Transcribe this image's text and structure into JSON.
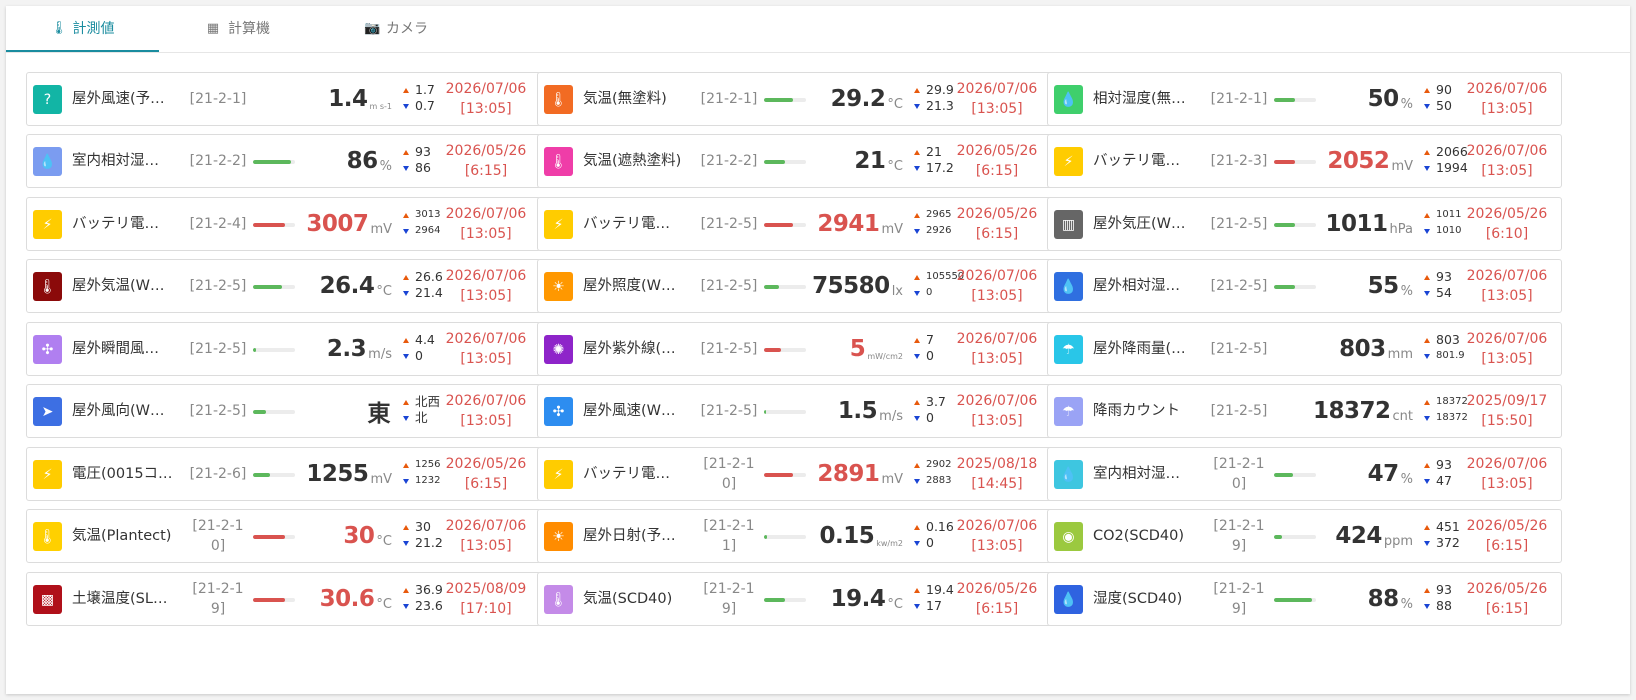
{
  "tabs": [
    {
      "label": "計測値",
      "icon": "thermometer-icon",
      "glyph": "🌡",
      "active": true
    },
    {
      "label": "計算機",
      "icon": "calculator-icon",
      "glyph": "▦",
      "active": false
    },
    {
      "label": "カメラ",
      "icon": "camera-icon",
      "glyph": "📷",
      "active": false
    }
  ],
  "colors": {
    "accent": "#1a8c9f",
    "alert": "#d9534f",
    "bar_ok": "#5cb85c",
    "bar_alert": "#d9534f"
  },
  "cards": [
    {
      "name": "屋外風速(予…",
      "id": "[21-2-1]",
      "value": "1.4",
      "unit": "m s-1",
      "unit_small": true,
      "max": "1.7",
      "min": "0.7",
      "date": "2026/07/06",
      "time": "[13:05]",
      "icon": "question-icon",
      "glyph": "?",
      "color": "#12b5a5",
      "bar": null,
      "alert": false
    },
    {
      "name": "気温(無塗料)",
      "id": "[21-2-1]",
      "value": "29.2",
      "unit": "°C",
      "max": "29.9",
      "min": "21.3",
      "date": "2026/07/06",
      "time": "[13:05]",
      "icon": "thermometer-icon",
      "glyph": "🌡",
      "color": "#f26b23",
      "bar": 0.7,
      "alert": false
    },
    {
      "name": "相対湿度(無…",
      "id": "[21-2-1]",
      "value": "50",
      "unit": "%",
      "max": "90",
      "min": "50",
      "date": "2026/07/06",
      "time": "[13:05]",
      "icon": "humidity-drop-icon",
      "glyph": "💧",
      "color": "#3fcf6c",
      "bar": 0.5,
      "alert": false
    },
    {
      "name": "室内相対湿…",
      "id": "[21-2-2]",
      "value": "86",
      "unit": "%",
      "max": "93",
      "min": "86",
      "date": "2026/05/26",
      "time": "[6:15]",
      "icon": "humidity-drop-icon",
      "glyph": "💧",
      "color": "#7b9cf0",
      "bar": 0.9,
      "alert": false
    },
    {
      "name": "気温(遮熱塗料)",
      "id": "[21-2-2]",
      "value": "21",
      "unit": "°C",
      "max": "21",
      "min": "17.2",
      "date": "2026/05/26",
      "time": "[6:15]",
      "icon": "thermometer-icon",
      "glyph": "🌡",
      "color": "#ef3da8",
      "bar": 0.5,
      "alert": false
    },
    {
      "name": "バッテリ電…",
      "id": "[21-2-3]",
      "value": "2052",
      "unit": "mV",
      "max": "2066",
      "min": "1994",
      "date": "2026/07/06",
      "time": "[13:05]",
      "icon": "battery-voltage-icon",
      "glyph": "⚡",
      "color": "#ffcc00",
      "bar": 0.5,
      "alert": true
    },
    {
      "name": "バッテリ電…",
      "id": "[21-2-4]",
      "value": "3007",
      "unit": "mV",
      "max": "3013",
      "min": "2964",
      "date": "2026/07/06",
      "time": "[13:05]",
      "icon": "battery-voltage-icon",
      "glyph": "⚡",
      "color": "#ffcc00",
      "bar": 0.75,
      "alert": true,
      "range_small": true
    },
    {
      "name": "バッテリ電…",
      "id": "[21-2-5]",
      "value": "2941",
      "unit": "mV",
      "max": "2965",
      "min": "2926",
      "date": "2026/05/26",
      "time": "[6:15]",
      "icon": "battery-voltage-icon",
      "glyph": "⚡",
      "color": "#ffcc00",
      "bar": 0.7,
      "alert": true,
      "range_small": true
    },
    {
      "name": "屋外気圧(W…",
      "id": "[21-2-5]",
      "value": "1011",
      "unit": "hPa",
      "max": "1011",
      "min": "1010",
      "date": "2026/05/26",
      "time": "[6:10]",
      "icon": "pressure-icon",
      "glyph": "▥",
      "color": "#666666",
      "bar": 0.5,
      "alert": false,
      "range_small": true
    },
    {
      "name": "屋外気温(W…",
      "id": "[21-2-5]",
      "value": "26.4",
      "unit": "°C",
      "max": "26.6",
      "min": "21.4",
      "date": "2026/07/06",
      "time": "[13:05]",
      "icon": "thermometer-icon",
      "glyph": "🌡",
      "color": "#8b0a0a",
      "bar": 0.7,
      "alert": false
    },
    {
      "name": "屋外照度(W…",
      "id": "[21-2-5]",
      "value": "75580",
      "unit": "lx",
      "max": "105550",
      "min": "0",
      "date": "2026/07/06",
      "time": "[13:05]",
      "icon": "illuminance-icon",
      "glyph": "☀",
      "color": "#ff9800",
      "bar": 0.35,
      "alert": false,
      "range_small": true
    },
    {
      "name": "屋外相対湿…",
      "id": "[21-2-5]",
      "value": "55",
      "unit": "%",
      "max": "93",
      "min": "54",
      "date": "2026/07/06",
      "time": "[13:05]",
      "icon": "humidity-drop-icon",
      "glyph": "💧",
      "color": "#2f6fe0",
      "bar": 0.5,
      "alert": false
    },
    {
      "name": "屋外瞬間風…",
      "id": "[21-2-5]",
      "value": "2.3",
      "unit": "m/s",
      "max": "4.4",
      "min": "0",
      "date": "2026/07/06",
      "time": "[13:05]",
      "icon": "wind-fan-icon",
      "glyph": "✣",
      "color": "#b07ff0",
      "bar": 0.08,
      "alert": false
    },
    {
      "name": "屋外紫外線(…",
      "id": "[21-2-5]",
      "value": "5",
      "unit": "mW/cm2",
      "unit_small": true,
      "max": "7",
      "min": "0",
      "date": "2026/07/06",
      "time": "[13:05]",
      "icon": "uv-icon",
      "glyph": "✺",
      "color": "#8e24c9",
      "bar": 0.4,
      "alert": true
    },
    {
      "name": "屋外降雨量(…",
      "id": "[21-2-5]",
      "value": "803",
      "unit": "mm",
      "max": "803",
      "min": "801.9",
      "date": "2026/07/06",
      "time": "[13:05]",
      "icon": "rain-umbrella-icon",
      "glyph": "☂",
      "color": "#29c6e8",
      "bar": null,
      "alert": false,
      "min_small": true
    },
    {
      "name": "屋外風向(W…",
      "id": "[21-2-5]",
      "value": "東",
      "unit": "",
      "max": "北西",
      "min": "北",
      "date": "2026/07/06",
      "time": "[13:05]",
      "icon": "compass-icon",
      "glyph": "➤",
      "color": "#3d6fe3",
      "bar": 0.3,
      "alert": false
    },
    {
      "name": "屋外風速(W…",
      "id": "[21-2-5]",
      "value": "1.5",
      "unit": "m/s",
      "max": "3.7",
      "min": "0",
      "date": "2026/07/06",
      "time": "[13:05]",
      "icon": "wind-fan-icon",
      "glyph": "✣",
      "color": "#2d8df0",
      "bar": 0.05,
      "alert": false
    },
    {
      "name": "降雨カウント",
      "id": "[21-2-5]",
      "value": "18372",
      "unit": "cnt",
      "max": "18372",
      "min": "18372",
      "date": "2025/09/17",
      "time": "[15:50]",
      "icon": "rain-umbrella-icon",
      "glyph": "☂",
      "color": "#9aa3f5",
      "bar": null,
      "alert": false,
      "range_small": true
    },
    {
      "name": "電圧(0015コ…",
      "id": "[21-2-6]",
      "value": "1255",
      "unit": "mV",
      "max": "1256",
      "min": "1232",
      "date": "2026/05/26",
      "time": "[6:15]",
      "icon": "battery-voltage-icon",
      "glyph": "⚡",
      "color": "#ffcc00",
      "bar": 0.4,
      "alert": false,
      "range_small": true
    },
    {
      "name": "バッテリ電…",
      "id": "[21-2-10]",
      "value": "2891",
      "unit": "mV",
      "max": "2902",
      "min": "2883",
      "date": "2025/08/18",
      "time": "[14:45]",
      "icon": "battery-voltage-icon",
      "glyph": "⚡",
      "color": "#ffcc00",
      "bar": 0.7,
      "alert": true,
      "range_small": true
    },
    {
      "name": "室内相対湿…",
      "id": "[21-2-10]",
      "value": "47",
      "unit": "%",
      "max": "93",
      "min": "47",
      "date": "2026/07/06",
      "time": "[13:05]",
      "icon": "humidity-drop-icon",
      "glyph": "💧",
      "color": "#3ec6e0",
      "bar": 0.45,
      "alert": false
    },
    {
      "name": "気温(Plantect)",
      "id": "[21-2-10]",
      "value": "30",
      "unit": "°C",
      "max": "30",
      "min": "21.2",
      "date": "2026/07/06",
      "time": "[13:05]",
      "icon": "thermometer-icon",
      "glyph": "🌡",
      "color": "#ffd000",
      "bar": 0.75,
      "alert": true
    },
    {
      "name": "屋外日射(予…",
      "id": "[21-2-11]",
      "value": "0.15",
      "unit": "kw/m2",
      "unit_small": true,
      "max": "0.16",
      "min": "0",
      "date": "2026/07/06",
      "time": "[13:05]",
      "icon": "solar-icon",
      "glyph": "☀",
      "color": "#ff8c00",
      "bar": 0.08,
      "alert": false
    },
    {
      "name": "CO2(SCD40)",
      "id": "[21-2-19]",
      "value": "424",
      "unit": "ppm",
      "max": "451",
      "min": "372",
      "date": "2026/05/26",
      "time": "[6:15]",
      "icon": "co2-icon",
      "glyph": "◉",
      "color": "#9bc93f",
      "bar": 0.2,
      "alert": false
    },
    {
      "name": "土壌温度(SL…",
      "id": "[21-2-19]",
      "value": "30.6",
      "unit": "°C",
      "max": "36.9",
      "min": "23.6",
      "date": "2025/08/09",
      "time": "[17:10]",
      "icon": "soil-icon",
      "glyph": "▩",
      "color": "#b0101a",
      "bar": 0.75,
      "alert": true
    },
    {
      "name": "気温(SCD40)",
      "id": "[21-2-19]",
      "value": "19.4",
      "unit": "°C",
      "max": "19.4",
      "min": "17",
      "date": "2026/05/26",
      "time": "[6:15]",
      "icon": "thermometer-icon",
      "glyph": "🌡",
      "color": "#c48be8",
      "bar": 0.5,
      "alert": false
    },
    {
      "name": "湿度(SCD40)",
      "id": "[21-2-19]",
      "value": "88",
      "unit": "%",
      "max": "93",
      "min": "88",
      "date": "2026/05/26",
      "time": "[6:15]",
      "icon": "humidity-drop-icon",
      "glyph": "💧",
      "color": "#2f63e0",
      "bar": 0.9,
      "alert": false
    }
  ]
}
